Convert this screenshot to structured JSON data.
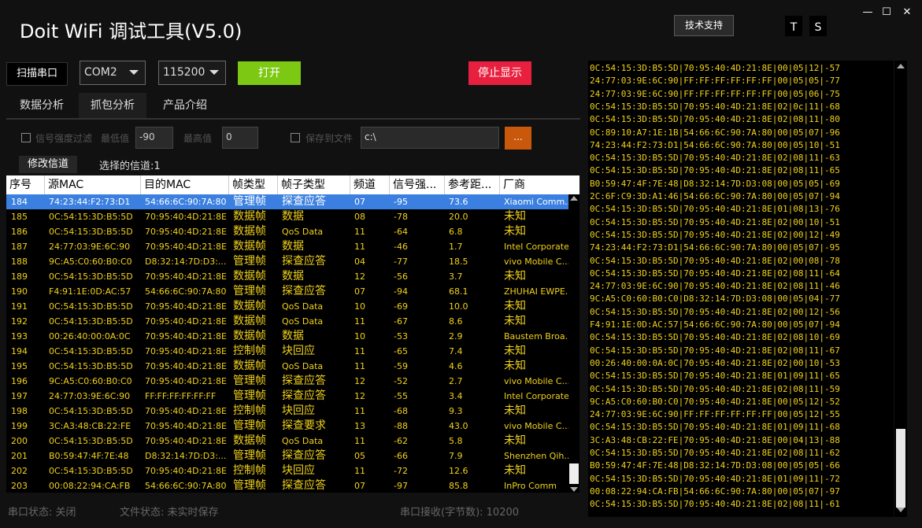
{
  "app": {
    "title": "Doit WiFi 调试工具(V5.0)",
    "support_label": "技术支持",
    "t_label": "T",
    "s_label": "S",
    "win_min": "—",
    "win_max": "☐",
    "win_close": "✕"
  },
  "toolbar": {
    "scan_label": "扫描串口",
    "port_value": "COM2",
    "baud_value": "115200",
    "open_label": "打开",
    "stop_label": "停止显示"
  },
  "tabs": [
    {
      "label": "数据分析"
    },
    {
      "label": "抓包分析"
    },
    {
      "label": "产品介绍"
    }
  ],
  "filters": {
    "rssi_filter_label": "信号强度过滤",
    "min_label": "最低值",
    "min_value": "-90",
    "max_label": "最高值",
    "max_value": "0",
    "save_label": "保存到文件",
    "path_value": "c:\\",
    "browse_label": "..."
  },
  "channel": {
    "edit_label": "修改信道",
    "selected_label": "选择的信道:1"
  },
  "table": {
    "columns": [
      "序号",
      "源MAC",
      "目的MAC",
      "帧类型",
      "帧子类型",
      "频道",
      "信号强...",
      "参考距...",
      "厂商"
    ],
    "rows": [
      [
        "184",
        "74:23:44:F2:73:D1",
        "54:66:6C:90:7A:80",
        "管理帧",
        "探查应答",
        "07",
        "-95",
        "73.6",
        "Xiaomi Comm..."
      ],
      [
        "185",
        "0C:54:15:3D:B5:5D",
        "70:95:40:4D:21:8E",
        "数据帧",
        "数据",
        "08",
        "-78",
        "20.0",
        "未知"
      ],
      [
        "186",
        "0C:54:15:3D:B5:5D",
        "70:95:40:4D:21:8E",
        "数据帧",
        "QoS Data",
        "11",
        "-64",
        "6.8",
        "未知"
      ],
      [
        "187",
        "24:77:03:9E:6C:90",
        "70:95:40:4D:21:8E",
        "数据帧",
        "数据",
        "11",
        "-46",
        "1.7",
        "Intel Corporate"
      ],
      [
        "188",
        "9C:A5:C0:60:B0:C0",
        "D8:32:14:7D:D3:...",
        "管理帧",
        "探查应答",
        "04",
        "-77",
        "18.5",
        "vivo Mobile C..."
      ],
      [
        "189",
        "0C:54:15:3D:B5:5D",
        "70:95:40:4D:21:8E",
        "数据帧",
        "数据",
        "12",
        "-56",
        "3.7",
        "未知"
      ],
      [
        "190",
        "F4:91:1E:0D:AC:57",
        "54:66:6C:90:7A:80",
        "管理帧",
        "探查应答",
        "07",
        "-94",
        "68.1",
        "ZHUHAI EWPE..."
      ],
      [
        "191",
        "0C:54:15:3D:B5:5D",
        "70:95:40:4D:21:8E",
        "数据帧",
        "QoS Data",
        "10",
        "-69",
        "10.0",
        "未知"
      ],
      [
        "192",
        "0C:54:15:3D:B5:5D",
        "70:95:40:4D:21:8E",
        "数据帧",
        "QoS Data",
        "11",
        "-67",
        "8.6",
        "未知"
      ],
      [
        "193",
        "00:26:40:00:0A:0C",
        "70:95:40:4D:21:8E",
        "数据帧",
        "数据",
        "10",
        "-53",
        "2.9",
        "Baustem Broa..."
      ],
      [
        "194",
        "0C:54:15:3D:B5:5D",
        "70:95:40:4D:21:8E",
        "控制帧",
        "块回应",
        "11",
        "-65",
        "7.4",
        "未知"
      ],
      [
        "195",
        "0C:54:15:3D:B5:5D",
        "70:95:40:4D:21:8E",
        "数据帧",
        "QoS Data",
        "11",
        "-59",
        "4.6",
        "未知"
      ],
      [
        "196",
        "9C:A5:C0:60:B0:C0",
        "70:95:40:4D:21:8E",
        "管理帧",
        "探查应答",
        "12",
        "-52",
        "2.7",
        "vivo Mobile C..."
      ],
      [
        "197",
        "24:77:03:9E:6C:90",
        "FF:FF:FF:FF:FF:FF",
        "管理帧",
        "探查应答",
        "12",
        "-55",
        "3.4",
        "Intel Corporate"
      ],
      [
        "198",
        "0C:54:15:3D:B5:5D",
        "70:95:40:4D:21:8E",
        "控制帧",
        "块回应",
        "11",
        "-68",
        "9.3",
        "未知"
      ],
      [
        "199",
        "3C:A3:48:CB:22:FE",
        "70:95:40:4D:21:8E",
        "管理帧",
        "探查要求",
        "13",
        "-88",
        "43.0",
        "vivo Mobile C..."
      ],
      [
        "200",
        "0C:54:15:3D:B5:5D",
        "70:95:40:4D:21:8E",
        "数据帧",
        "QoS Data",
        "11",
        "-62",
        "5.8",
        "未知"
      ],
      [
        "201",
        "B0:59:47:4F:7E:48",
        "D8:32:14:7D:D3:...",
        "管理帧",
        "探查应答",
        "05",
        "-66",
        "7.9",
        "Shenzhen Qih..."
      ],
      [
        "202",
        "0C:54:15:3D:B5:5D",
        "70:95:40:4D:21:8E",
        "控制帧",
        "块回应",
        "11",
        "-72",
        "12.6",
        "未知"
      ],
      [
        "203",
        "00:08:22:94:CA:FB",
        "54:66:6C:90:7A:80",
        "管理帧",
        "探查应答",
        "07",
        "-97",
        "85.8",
        "InPro Comm"
      ]
    ]
  },
  "status": {
    "port": "串口状态: 关闭",
    "file": "文件状态: 未实时保存",
    "recv": "串口接收(字节数): 10200"
  },
  "log": [
    "0C:54:15:3D:B5:5D|70:95:40:4D:21:8E|00|05|12|-57",
    "24:77:03:9E:6C:90|FF:FF:FF:FF:FF:FF|00|05|05|-77",
    "24:77:03:9E:6C:90|FF:FF:FF:FF:FF:FF|00|05|06|-75",
    "0C:54:15:3D:B5:5D|70:95:40:4D:21:8E|02|0c|11|-68",
    "0C:54:15:3D:B5:5D|70:95:40:4D:21:8E|02|08|11|-80",
    "0C:89:10:A7:1E:1B|54:66:6C:90:7A:80|00|05|07|-96",
    "74:23:44:F2:73:D1|54:66:6C:90:7A:80|00|05|10|-51",
    "0C:54:15:3D:B5:5D|70:95:40:4D:21:8E|02|08|11|-63",
    "0C:54:15:3D:B5:5D|70:95:40:4D:21:8E|02|08|11|-65",
    "B0:59:47:4F:7E:48|D8:32:14:7D:D3:08|00|05|05|-69",
    "2C:6F:C9:3D:A1:46|54:66:6C:90:7A:80|00|05|07|-94",
    "0C:54:15:3D:B5:5D|70:95:40:4D:21:8E|01|08|13|-76",
    "0C:54:15:3D:B5:5D|70:95:40:4D:21:8E|02|00|10|-51",
    "0C:54:15:3D:B5:5D|70:95:40:4D:21:8E|02|00|12|-49",
    "74:23:44:F2:73:D1|54:66:6C:90:7A:80|00|05|07|-95",
    "0C:54:15:3D:B5:5D|70:95:40:4D:21:8E|02|00|08|-78",
    "0C:54:15:3D:B5:5D|70:95:40:4D:21:8E|02|08|11|-64",
    "24:77:03:9E:6C:90|70:95:40:4D:21:8E|02|08|11|-46",
    "9C:A5:C0:60:B0:C0|D8:32:14:7D:D3:08|00|05|04|-77",
    "0C:54:15:3D:B5:5D|70:95:40:4D:21:8E|02|00|12|-56",
    "F4:91:1E:0D:AC:57|54:66:6C:90:7A:80|00|05|07|-94",
    "0C:54:15:3D:B5:5D|70:95:40:4D:21:8E|02|08|10|-69",
    "0C:54:15:3D:B5:5D|70:95:40:4D:21:8E|02|08|11|-67",
    "00:26:40:00:0A:0C|70:95:40:4D:21:8E|02|00|10|-53",
    "0C:54:15:3D:B5:5D|70:95:40:4D:21:8E|01|09|11|-65",
    "0C:54:15:3D:B5:5D|70:95:40:4D:21:8E|02|08|11|-59",
    "9C:A5:C0:60:B0:C0|70:95:40:4D:21:8E|00|05|12|-52",
    "24:77:03:9E:6C:90|FF:FF:FF:FF:FF:FF|00|05|12|-55",
    "0C:54:15:3D:B5:5D|70:95:40:4D:21:8E|01|09|11|-68",
    "3C:A3:48:CB:22:FE|70:95:40:4D:21:8E|00|04|13|-88",
    "0C:54:15:3D:B5:5D|70:95:40:4D:21:8E|02|08|11|-62",
    "B0:59:47:4F:7E:48|D8:32:14:7D:D3:08|00|05|05|-66",
    "0C:54:15:3D:B5:5D|70:95:40:4D:21:8E|01|09|11|-72",
    "00:08:22:94:CA:FB|54:66:6C:90:7A:80|00|05|07|-97",
    "0C:54:15:3D:B5:5D|70:95:40:4D:21:8E|02|08|11|-61"
  ],
  "colors": {
    "accent_green": "#7cc812",
    "accent_red": "#e8203f",
    "accent_orange": "#c8580c",
    "selection_blue": "#3b80e0",
    "data_yellow": "#f2d21a"
  }
}
